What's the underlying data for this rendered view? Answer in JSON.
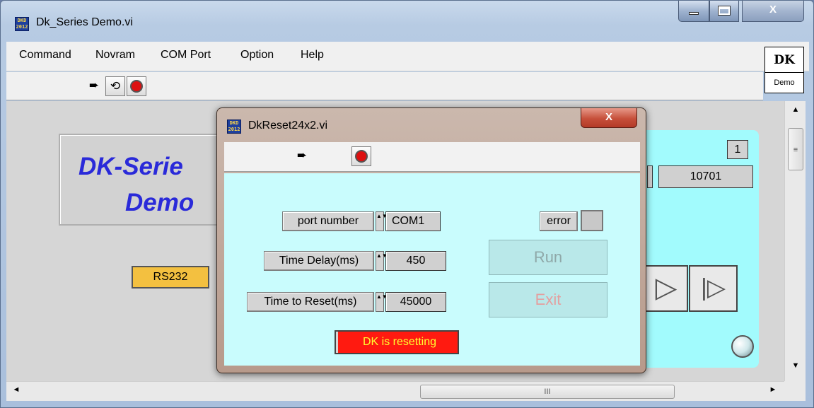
{
  "main_window": {
    "title": "Dk_Series Demo.vi",
    "icon_text": "DKD\n2012",
    "close_glyph": "X",
    "menu": [
      "Command",
      "Novram",
      "COM Port",
      "Option",
      "Help"
    ],
    "toolbar": {
      "run_icon": "➨",
      "run_continuous_icon": "⟲",
      "abort_icon": "stop-icon"
    },
    "logo": {
      "top": "DK",
      "bottom": "Demo"
    },
    "front_panel": {
      "title_line1": "DK-Serie",
      "title_line2": "Demo",
      "rs232_label": "RS232",
      "indicator_value": "1",
      "numeric_display": "10701",
      "play_glyph": "▷",
      "step_glyph": "|▷"
    },
    "scrollbars": {
      "up_arrow": "▲",
      "down_arrow": "▼",
      "left_arrow": "◄",
      "right_arrow": "►",
      "thumb_grip_v": "≡",
      "thumb_grip_h": "III"
    }
  },
  "dialog": {
    "title": "DkReset24x2.vi",
    "icon_text": "DKD\n2012",
    "close_glyph": "X",
    "toolbar": {
      "run_icon": "➨",
      "abort_icon": "stop-icon"
    },
    "fields": [
      {
        "label": "port number",
        "value": "COM1"
      },
      {
        "label": "Time Delay(ms)",
        "value": "450"
      },
      {
        "label": "Time to Reset(ms)",
        "value": "45000"
      }
    ],
    "spinner_glyph": "▲▼",
    "error_label": "error",
    "run_button": "Run",
    "exit_button": "Exit",
    "status": "DK is resetting"
  },
  "colors": {
    "panel_cyan": "#c9fcfd",
    "title_blue": "#2a2ad9",
    "rs232_orange": "#f3c040",
    "status_red": "#ff1a10",
    "status_text": "#ffff30"
  }
}
